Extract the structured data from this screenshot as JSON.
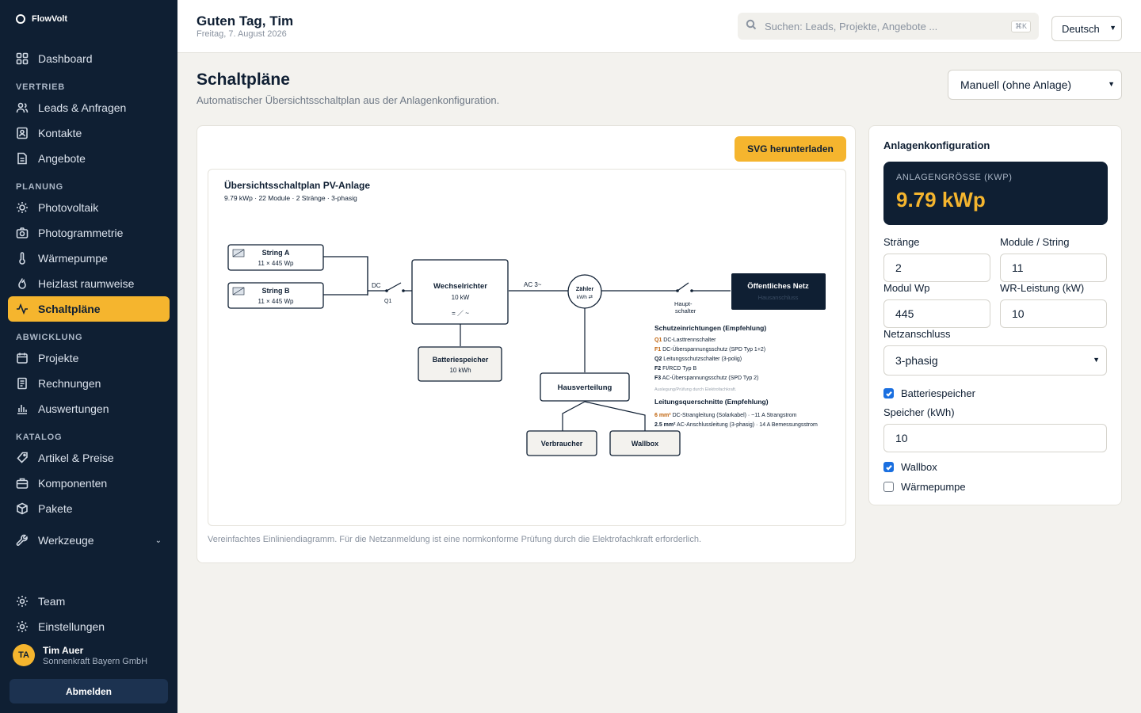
{
  "app": {
    "brand": "FlowVolt"
  },
  "sidebar": {
    "items": [
      {
        "label": "Dashboard"
      },
      {
        "label": "Leads & Anfragen"
      },
      {
        "label": "Kontakte"
      },
      {
        "label": "Angebote"
      },
      {
        "label": "Photovoltaik"
      },
      {
        "label": "Photogrammetrie"
      },
      {
        "label": "Wärmepumpe"
      },
      {
        "label": "Heizlast raumweise"
      },
      {
        "label": "Schaltpläne"
      },
      {
        "label": "Projekte"
      },
      {
        "label": "Rechnungen"
      },
      {
        "label": "Auswertungen"
      },
      {
        "label": "Artikel & Preise"
      },
      {
        "label": "Komponenten"
      },
      {
        "label": "Pakete"
      },
      {
        "label": "Werkzeuge"
      },
      {
        "label": "Team"
      },
      {
        "label": "Einstellungen"
      }
    ],
    "sections": [
      "VERTRIEB",
      "PLANUNG",
      "ABWICKLUNG",
      "KATALOG"
    ],
    "active": "Schaltpläne",
    "user": {
      "initials": "TA",
      "name": "Tim Auer",
      "company": "Sonnenkraft Bayern GmbH"
    },
    "logout_label": "Abmelden"
  },
  "topbar": {
    "greeting": "Guten Tag, Tim",
    "date": "Freitag, 7. August 2026",
    "search_placeholder": "Suchen: Leads, Projekte, Angebote ...",
    "search_shortcut": "⌘K",
    "language": "Deutsch"
  },
  "page": {
    "title": "Schaltpläne",
    "subtitle": "Automatischer Übersichtsschaltplan aus der Anlagenkonfiguration.",
    "mode": "Manuell (ohne Anlage)",
    "download_label": "SVG herunterladen",
    "note": "Vereinfachtes Einliniendiagramm. Für die Netzanmeldung ist eine normkonforme Prüfung durch die Elektrofachkraft erforderlich."
  },
  "diagram": {
    "title": "Übersichtsschaltplan PV-Anlage",
    "subtitle": "9.79 kWp · 22 Module · 2 Stränge · 3-phasig",
    "string_a": {
      "name": "String A",
      "spec": "11 × 445 Wp"
    },
    "string_b": {
      "name": "String B",
      "spec": "11 × 445 Wp"
    },
    "dc_label": "DC",
    "q1_label": "Q1",
    "inverter": {
      "name": "Wechselrichter",
      "power": "10 kW",
      "symbol": "= ／ ~"
    },
    "ac_label": "AC 3~",
    "meter": {
      "name": "Zähler",
      "unit": "kWh ⇄"
    },
    "main_switch_line1": "Haupt-",
    "main_switch_line2": "schalter",
    "grid": {
      "name": "Öffentliches Netz",
      "sub": "Hausanschluss"
    },
    "battery": {
      "name": "Batteriespeicher",
      "capacity": "10 kWh"
    },
    "distribution": "Hausverteilung",
    "consumer": "Verbraucher",
    "wallbox": "Wallbox",
    "protection_title": "Schutzeinrichtungen (Empfehlung)",
    "protection": [
      {
        "code": "Q1",
        "text": "DC-Lasttrennschalter"
      },
      {
        "code": "F1",
        "text": "DC-Überspannungsschutz (SPD Typ 1+2)"
      },
      {
        "code": "Q2",
        "text": "Leitungsschutzschalter (3-polig)"
      },
      {
        "code": "F2",
        "text": "FI/RCD Typ B"
      },
      {
        "code": "F3",
        "text": "AC-Überspannungsschutz (SPD Typ 2)"
      }
    ],
    "protection_note": "Auslegung/Prüfung durch Elektrofachkraft.",
    "cable_title": "Leitungsquerschnitte (Empfehlung)",
    "cables": [
      {
        "size": "6 mm²",
        "text": "DC-Strangleitung (Solarkabel) · ~11 A Strangstrom"
      },
      {
        "size": "2.5 mm²",
        "text": "AC-Anschlussleitung (3-phasig) · 14 A Bemessungsstrom"
      }
    ]
  },
  "config": {
    "title": "Anlagenkonfiguration",
    "kpi_label": "ANLAGENGRÖSSE (KWP)",
    "kpi_value": "9.79 kWp",
    "strings_label": "Stränge",
    "strings_value": "2",
    "modules_label": "Module / String",
    "modules_value": "11",
    "wp_label": "Modul Wp",
    "wp_value": "445",
    "inverter_label": "WR-Leistung (kW)",
    "inverter_value": "10",
    "grid_label": "Netzanschluss",
    "grid_value": "3-phasig",
    "battery_label": "Batteriespeicher",
    "battery_checked": true,
    "storage_label": "Speicher (kWh)",
    "storage_value": "10",
    "wallbox_label": "Wallbox",
    "wallbox_checked": true,
    "heatpump_label": "Wärmepumpe",
    "heatpump_checked": false
  },
  "colors": {
    "navy": "#0f1f33",
    "accent": "#f5b52e",
    "code_orange": "#c0620a"
  }
}
